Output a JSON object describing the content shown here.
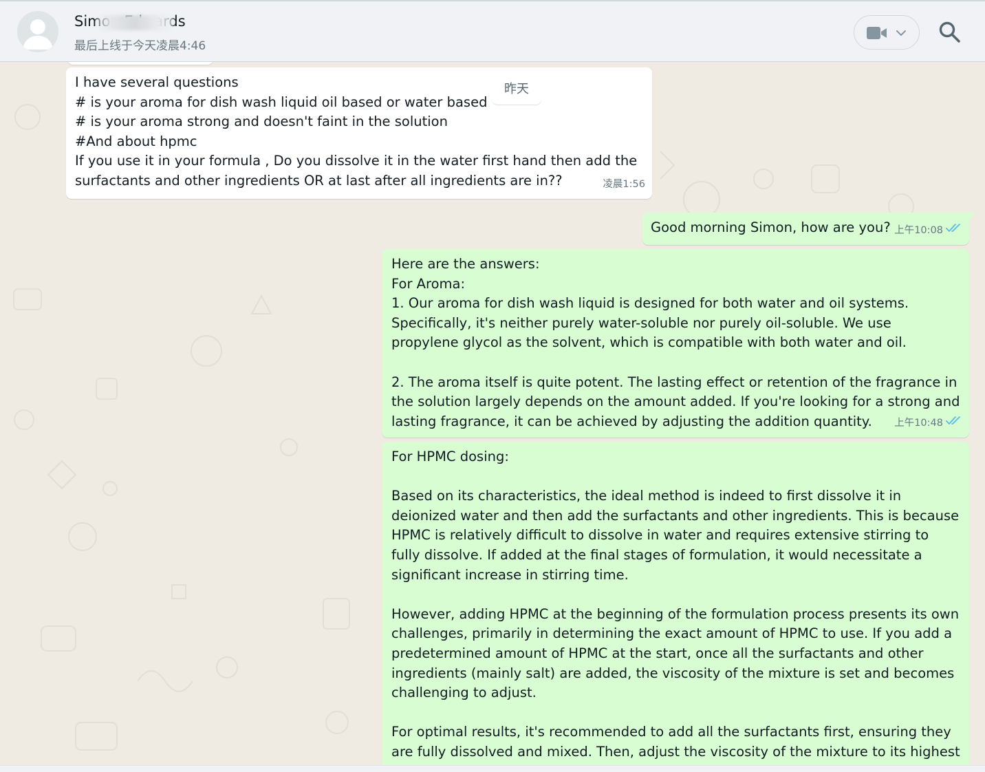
{
  "header": {
    "contact_name": "Simon Edwards",
    "last_seen": "最后上线于今天凌晨4:46",
    "video_call_icon": "video-camera-icon",
    "video_menu_icon": "chevron-down-icon",
    "search_icon": "search-icon",
    "avatar_icon": "default-avatar-icon"
  },
  "chat": {
    "day_chip": "昨天",
    "messages": [
      {
        "direction": "incoming",
        "text": "I have several questions\n# is your aroma for dish wash liquid oil based or water based\n# is your aroma strong and doesn't faint in the solution\n#And about hpmc\nIf you use it in your formula , Do you dissolve it in the water first hand then add the surfactants and other ingredients OR at last after all ingredients are in??",
        "time": "凌晨1:56"
      },
      {
        "direction": "outgoing",
        "text": "Good morning Simon, how are you?",
        "time": "上午10:08",
        "status": "read"
      },
      {
        "direction": "outgoing",
        "text": "Here are the answers:\nFor Aroma:\n1. Our aroma for dish wash liquid is designed for both water and oil systems. Specifically, it's neither purely water-soluble nor purely oil-soluble. We use propylene glycol as the solvent, which is compatible with both water and oil.\n\n2. The aroma itself is quite potent. The lasting effect or retention of the fragrance in the solution largely depends on the amount added. If you're looking for a strong and lasting fragrance, it can be achieved by adjusting the addition quantity.",
        "time": "上午10:48",
        "status": "read"
      },
      {
        "direction": "outgoing",
        "text": "For HPMC dosing:\n\nBased on its characteristics, the ideal method is indeed to first dissolve it in deionized water and then add the surfactants and other ingredients. This is because HPMC is relatively difficult to dissolve in water and requires extensive stirring to fully dissolve. If added at the final stages of formulation, it would necessitate a significant increase in stirring time.\n\nHowever, adding HPMC at the beginning of the formulation process presents its own challenges, primarily in determining the exact amount of HPMC to use. If you add a predetermined amount of HPMC at the start, once all the surfactants and other ingredients (mainly salt) are added, the viscosity of the mixture is set and becomes challenging to adjust.\n\nFor optimal results, it's recommended to add all the surfactants first, ensuring they are fully dissolved and mixed. Then, adjust the viscosity of the mixture to its highest value",
        "time": "",
        "status": ""
      }
    ]
  },
  "colors": {
    "header_bg": "#f0f2f5",
    "chat_bg": "#efeae2",
    "incoming_bubble": "#ffffff",
    "outgoing_bubble": "#d9fdd3",
    "read_ticks": "#53bdeb",
    "secondary_text": "#667781",
    "primary_text": "#111b21"
  }
}
